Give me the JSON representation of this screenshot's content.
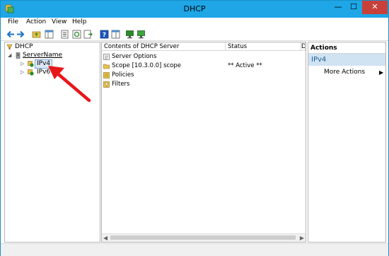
{
  "window": {
    "title": "DHCP",
    "controls": {
      "minimize": "—",
      "maximize": "☐",
      "close": "✕"
    }
  },
  "menu": [
    "File",
    "Action",
    "View",
    "Help"
  ],
  "tree": {
    "root": "DHCP",
    "server": "ServerName",
    "children": [
      "IPv4",
      "IPv6"
    ]
  },
  "content": {
    "columns": [
      "Contents of DHCP Server",
      "Status",
      "D"
    ],
    "rows": [
      {
        "name": "Server Options",
        "status": ""
      },
      {
        "name": "Scope [10.3.0.0] scope",
        "status": "** Active **"
      },
      {
        "name": "Policies",
        "status": ""
      },
      {
        "name": "Filters",
        "status": ""
      }
    ]
  },
  "actions": {
    "header": "Actions",
    "selected": "IPv4",
    "items": [
      "More Actions"
    ]
  },
  "icons": {
    "accent": "#1ea6e6",
    "close": "#c7403a",
    "arrow": "#e8161b"
  }
}
